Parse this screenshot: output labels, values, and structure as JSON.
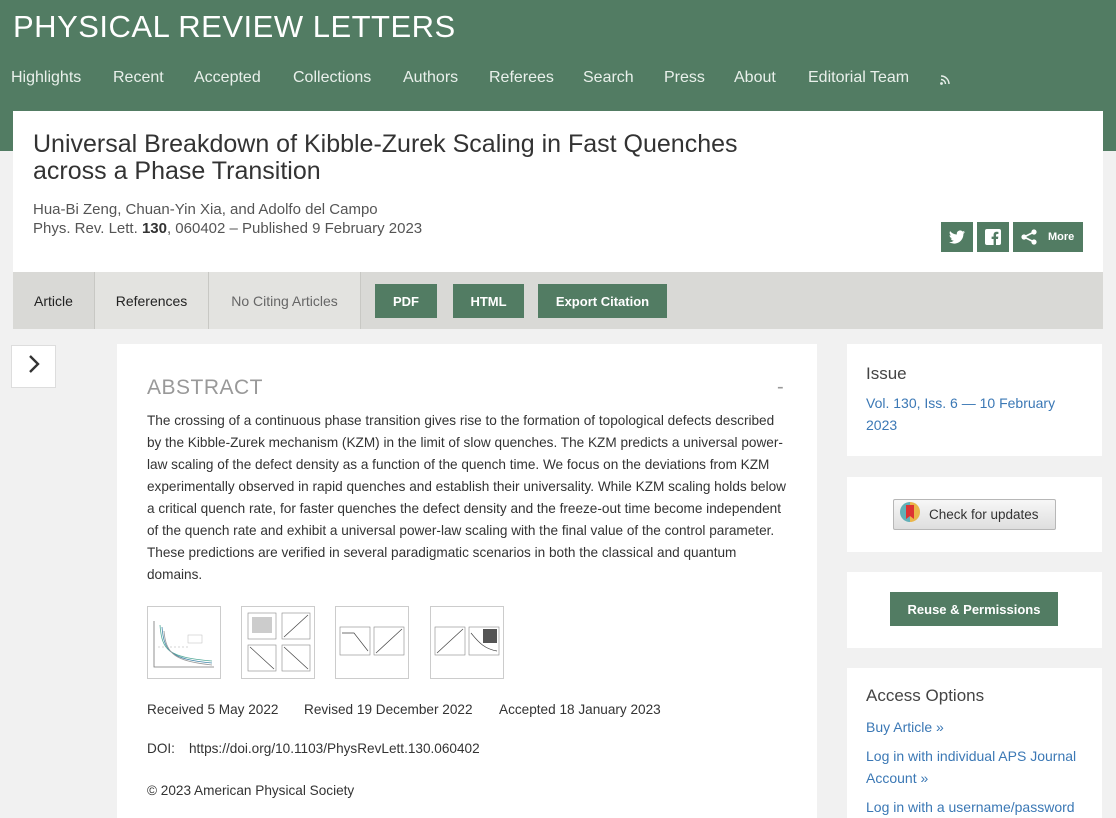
{
  "site": {
    "title": "PHYSICAL REVIEW LETTERS"
  },
  "nav": [
    "Highlights",
    "Recent",
    "Accepted",
    "Collections",
    "Authors",
    "Referees",
    "Search",
    "Press",
    "About",
    "Editorial Team"
  ],
  "nav_rss_icon": "rss-icon",
  "article": {
    "title": "Universal Breakdown of Kibble-Zurek Scaling in Fast Quenches across a Phase Transition",
    "authors": "Hua-Bi Zeng, Chuan-Yin Xia, and Adolfo del Campo",
    "journal": "Phys. Rev. Lett.",
    "volume": "130",
    "citation_rest": ", 060402 – Published 9 February 2023"
  },
  "share": {
    "more_label": "More",
    "icons": [
      "twitter-icon",
      "facebook-icon",
      "share-icon"
    ]
  },
  "tabs": {
    "article": "Article",
    "references": "References",
    "citing": "No Citing Articles",
    "pdf": "PDF",
    "html": "HTML",
    "export": "Export Citation"
  },
  "abstract": {
    "heading": "ABSTRACT",
    "collapse": "-",
    "text": "The crossing of a continuous phase transition gives rise to the formation of topological defects described by the Kibble-Zurek mechanism (KZM) in the limit of slow quenches. The KZM predicts a universal power-law scaling of the defect density as a function of the quench time. We focus on the deviations from KZM experimentally observed in rapid quenches and establish their universality. While KZM scaling holds below a critical quench rate, for faster quenches the defect density and the freeze-out time become independent of the quench rate and exhibit a universal power-law scaling with the final value of the control parameter. These predictions are verified in several paradigmatic scenarios in both the classical and quantum domains.",
    "received": "Received 5 May 2022",
    "revised": "Revised 19 December 2022",
    "accepted": "Accepted 18 January 2023",
    "doi_label": "DOI:",
    "doi": "https://doi.org/10.1103/PhysRevLett.130.060402",
    "copyright": "© 2023 American Physical Society"
  },
  "sidebar": {
    "issue_heading": "Issue",
    "issue_link": "Vol. 130, Iss. 6 — 10 February 2023",
    "check_updates": "Check for updates",
    "reuse": "Reuse & Permissions",
    "access_heading": "Access Options",
    "access_links": [
      "Buy Article »",
      "Log in with individual APS Journal Account »",
      "Log in with a username/password"
    ]
  },
  "colors": {
    "brand_green": "#527c63",
    "link_blue": "#3b78b5"
  }
}
